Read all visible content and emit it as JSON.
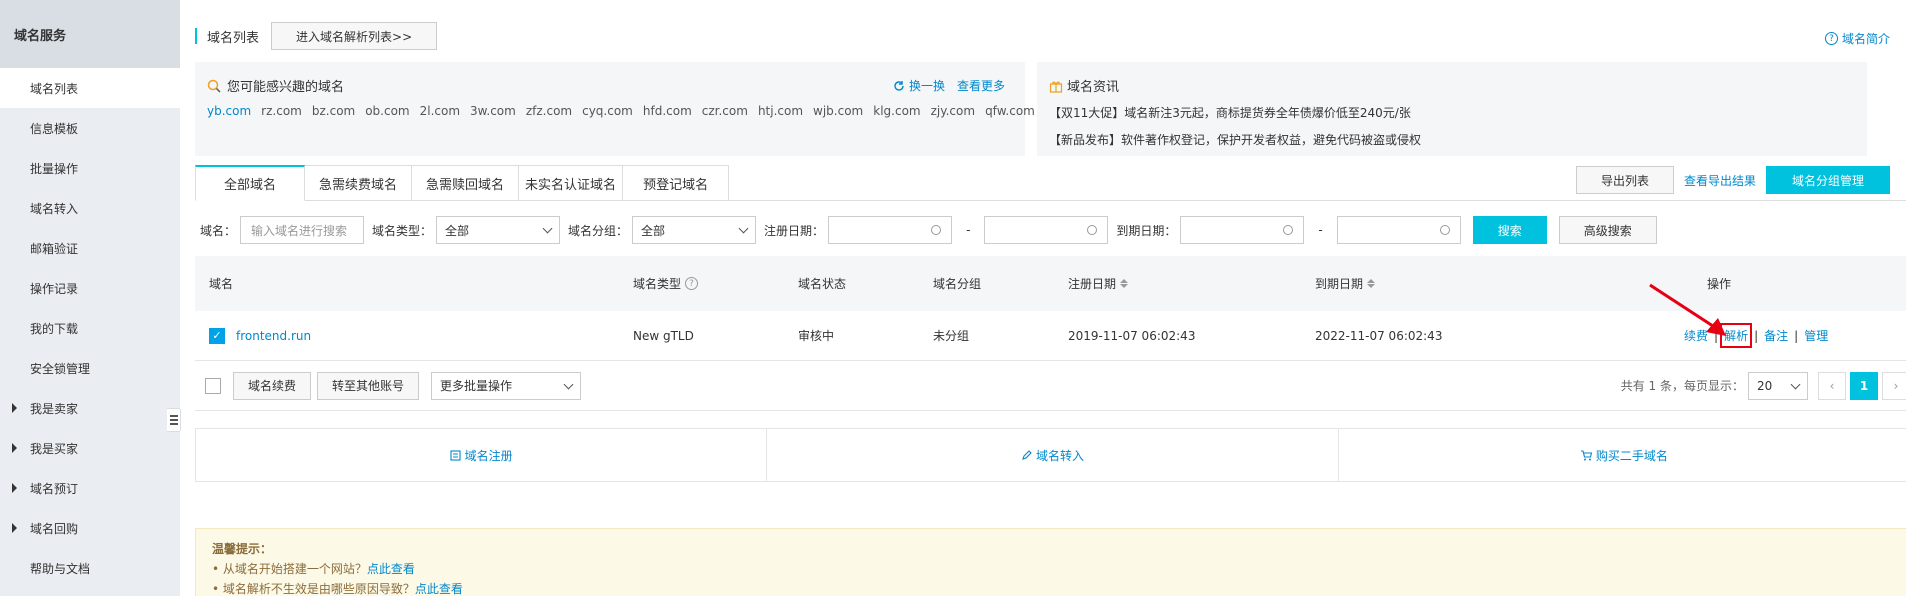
{
  "sidebar": {
    "header": "域名服务",
    "items": [
      {
        "label": "域名列表",
        "active": true
      },
      {
        "label": "信息模板"
      },
      {
        "label": "批量操作"
      },
      {
        "label": "域名转入"
      },
      {
        "label": "邮箱验证"
      },
      {
        "label": "操作记录"
      },
      {
        "label": "我的下载"
      },
      {
        "label": "安全锁管理"
      },
      {
        "label": "我是卖家",
        "expandable": true
      },
      {
        "label": "我是买家",
        "expandable": true
      },
      {
        "label": "域名预订",
        "expandable": true
      },
      {
        "label": "域名回购",
        "expandable": true
      },
      {
        "label": "帮助与文档"
      }
    ]
  },
  "header": {
    "title": "域名列表",
    "enter_dns_button": "进入域名解析列表>>",
    "intro_link": "域名简介",
    "intro_icon": "question-circle-icon"
  },
  "suggest": {
    "title": "您可能感兴趣的域名",
    "icon": "magnifier-icon",
    "refresh": "换一换",
    "more": "查看更多",
    "domains": [
      "yb.com",
      "rz.com",
      "bz.com",
      "ob.com",
      "2l.com",
      "3w.com",
      "zfz.com",
      "cyq.com",
      "hfd.com",
      "czr.com",
      "htj.com",
      "wjb.com",
      "klg.com",
      "zjy.com",
      "qfw.com"
    ]
  },
  "news": {
    "title": "域名资讯",
    "icon": "gift-icon",
    "items": [
      "【双11大促】域名新注3元起，商标提货券全年债爆价低至240元/张",
      "【新品发布】软件著作权登记，保护开发者权益，避免代码被盗或侵权"
    ]
  },
  "tabs": [
    "全部域名",
    "急需续费域名",
    "急需赎回域名",
    "未实名认证域名",
    "预登记域名"
  ],
  "toolbar": {
    "export": "导出列表",
    "view_export": "查看导出结果",
    "group_manage": "域名分组管理"
  },
  "filters": {
    "domain_label": "域名：",
    "domain_placeholder": "输入域名进行搜索",
    "type_label": "域名类型：",
    "type_value": "全部",
    "group_label": "域名分组：",
    "group_value": "全部",
    "reg_label": "注册日期：",
    "dash": "-",
    "exp_label": "到期日期：",
    "search": "搜索",
    "advanced": "高级搜索"
  },
  "table": {
    "columns": [
      "域名",
      "域名类型",
      "域名状态",
      "域名分组",
      "注册日期",
      "到期日期",
      "操作"
    ],
    "rows": [
      {
        "domain": "frontend.run",
        "type": "New gTLD",
        "status": "审核中",
        "group": "未分组",
        "reg_date": "2019-11-07 06:02:43",
        "exp_date": "2022-11-07 06:02:43",
        "ops": [
          "续费",
          "解析",
          "备注",
          "管理"
        ]
      }
    ],
    "op_sep": "|"
  },
  "bulk": {
    "renew": "域名续费",
    "transfer": "转至其他账号",
    "more": "更多批量操作",
    "summary": "共有 1 条，每页显示：",
    "page_size": "20",
    "current_page": "1",
    "prev": "‹",
    "next": "›"
  },
  "quick": {
    "register": "域名注册",
    "transfer_in": "域名转入",
    "buy_second": "购买二手域名"
  },
  "tips": {
    "title": "温馨提示：",
    "items": [
      {
        "text": "• 从域名开始搭建一个网站？",
        "link": "点此查看"
      },
      {
        "text": "• 域名解析不生效是由哪些原因导致？",
        "link": "点此查看"
      }
    ]
  },
  "colors": {
    "accent": "#00c1de",
    "link": "#0088cc",
    "highlight": "#e60012"
  }
}
